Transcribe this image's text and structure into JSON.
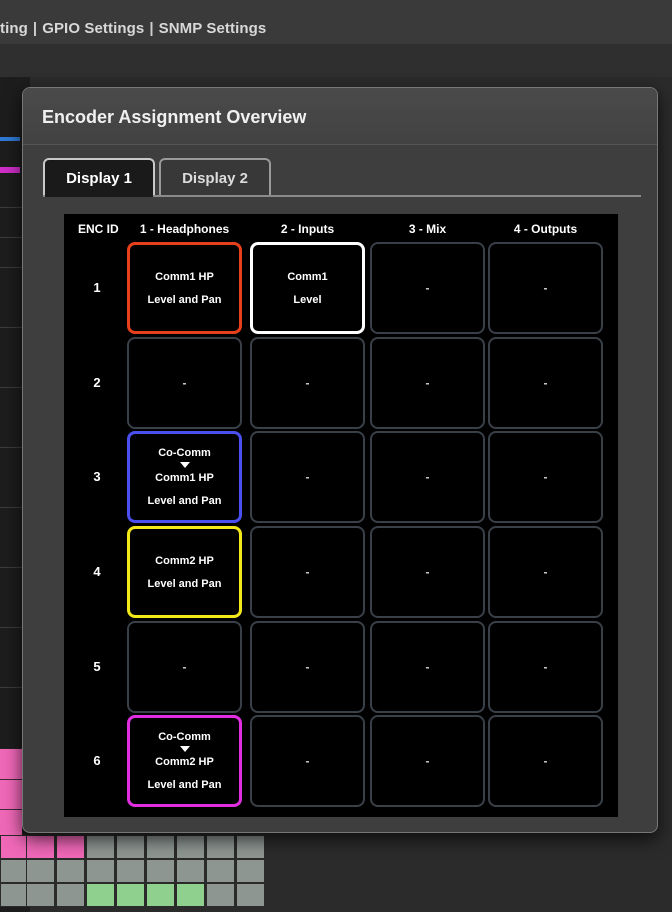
{
  "topbar": {
    "tabs": [
      "ting",
      "GPIO Settings",
      "SNMP Settings"
    ]
  },
  "dialog": {
    "title": "Encoder Assignment Overview",
    "tabs": [
      {
        "label": "Display 1",
        "active": true
      },
      {
        "label": "Display 2",
        "active": false
      }
    ]
  },
  "grid": {
    "id_header": "ENC ID",
    "columns": [
      "1 - Headphones",
      "2 - Inputs",
      "3 - Mix",
      "4 - Outputs"
    ],
    "rows": [
      {
        "id": "1",
        "cells": [
          {
            "lines": [
              "Comm1 HP",
              "Level and Pan"
            ],
            "border": "#e8401c"
          },
          {
            "lines": [
              "Comm1",
              "Level"
            ],
            "border": "#ffffff"
          },
          {
            "lines": [
              "-"
            ],
            "border": null
          },
          {
            "lines": [
              "-"
            ],
            "border": null
          }
        ]
      },
      {
        "id": "2",
        "cells": [
          {
            "lines": [
              "-"
            ],
            "border": null
          },
          {
            "lines": [
              "-"
            ],
            "border": null
          },
          {
            "lines": [
              "-"
            ],
            "border": null
          },
          {
            "lines": [
              "-"
            ],
            "border": null
          }
        ]
      },
      {
        "id": "3",
        "cells": [
          {
            "lines": [
              "Co-Comm",
              "Comm1 HP",
              "Level and Pan"
            ],
            "arrow": true,
            "border": "#4a50f0"
          },
          {
            "lines": [
              "-"
            ],
            "border": null
          },
          {
            "lines": [
              "-"
            ],
            "border": null
          },
          {
            "lines": [
              "-"
            ],
            "border": null
          }
        ]
      },
      {
        "id": "4",
        "cells": [
          {
            "lines": [
              "Comm2 HP",
              "Level and Pan"
            ],
            "border": "#f2e81a"
          },
          {
            "lines": [
              "-"
            ],
            "border": null
          },
          {
            "lines": [
              "-"
            ],
            "border": null
          },
          {
            "lines": [
              "-"
            ],
            "border": null
          }
        ]
      },
      {
        "id": "5",
        "cells": [
          {
            "lines": [
              "-"
            ],
            "border": null
          },
          {
            "lines": [
              "-"
            ],
            "border": null
          },
          {
            "lines": [
              "-"
            ],
            "border": null
          },
          {
            "lines": [
              "-"
            ],
            "border": null
          }
        ]
      },
      {
        "id": "6",
        "cells": [
          {
            "lines": [
              "Co-Comm",
              "Comm2 HP",
              "Level and Pan"
            ],
            "arrow": true,
            "border": "#e02ee0"
          },
          {
            "lines": [
              "-"
            ],
            "border": null
          },
          {
            "lines": [
              "-"
            ],
            "border": null
          },
          {
            "lines": [
              "-"
            ],
            "border": null
          }
        ]
      }
    ]
  }
}
